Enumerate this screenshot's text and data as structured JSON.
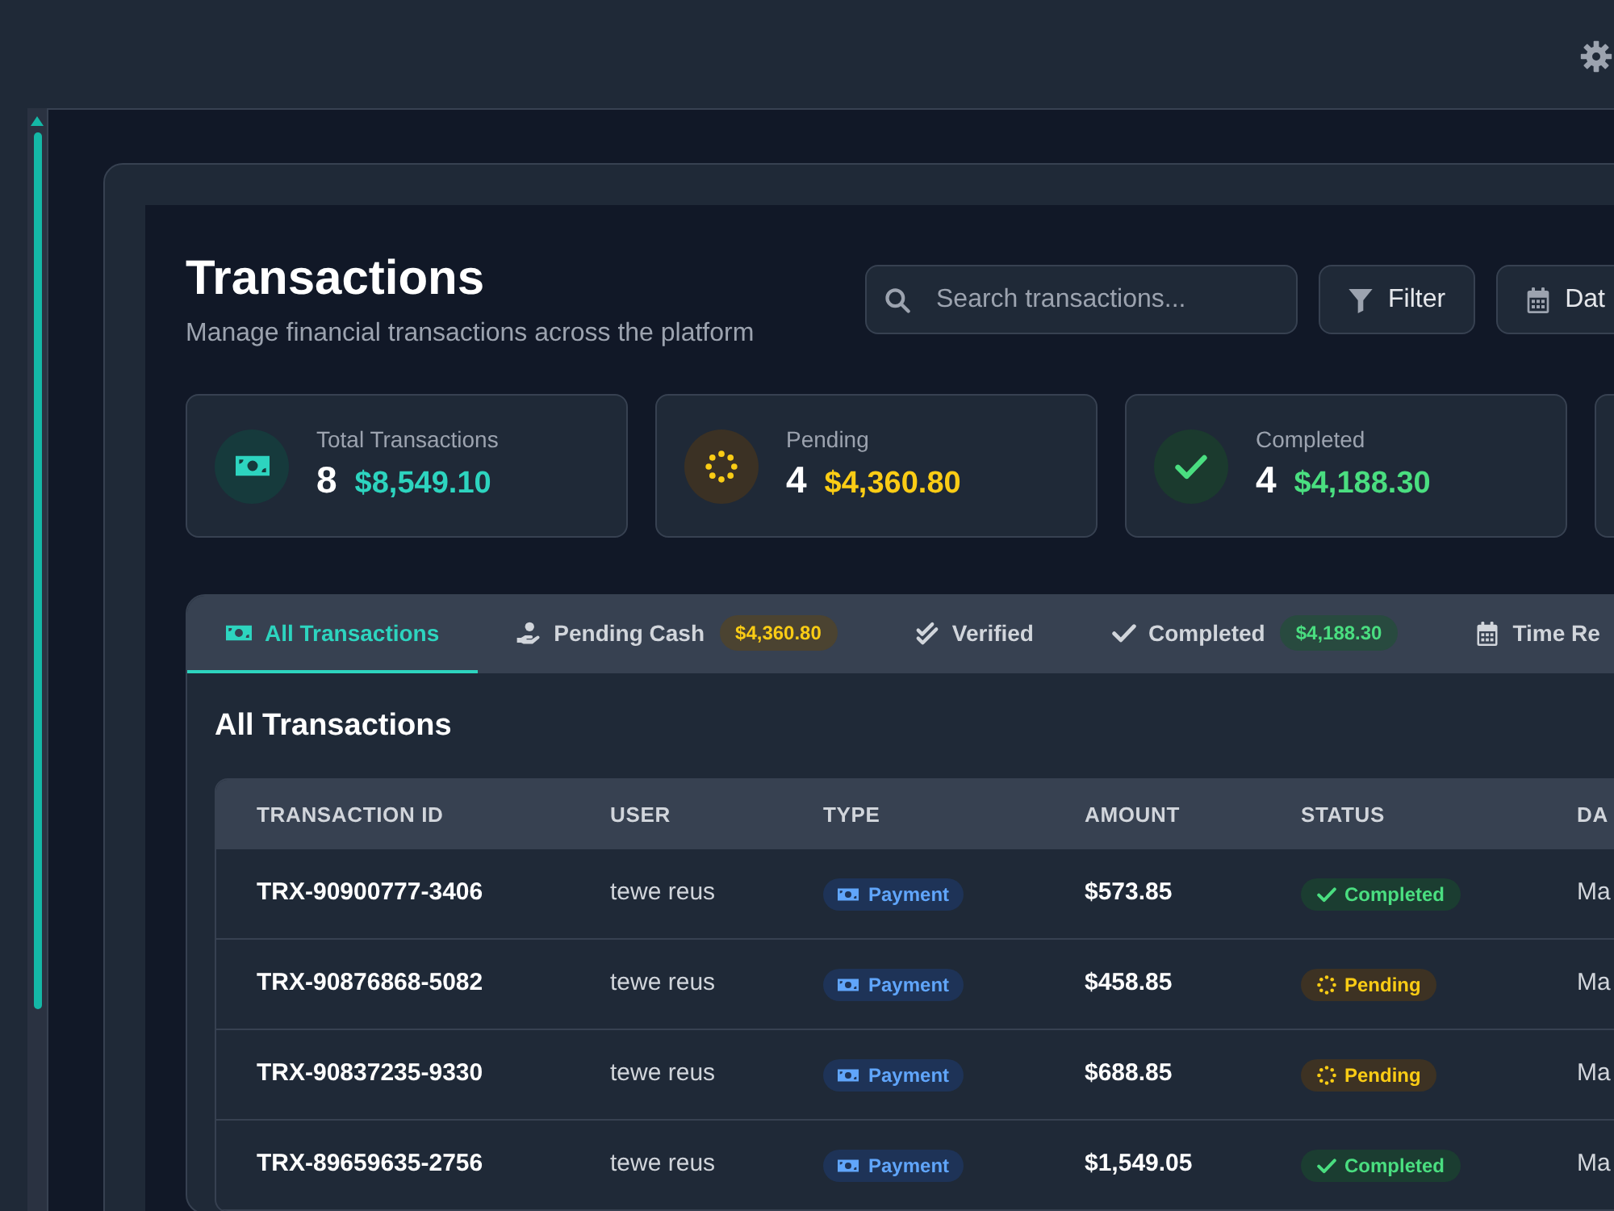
{
  "header": {
    "title": "Transactions",
    "subtitle": "Manage financial transactions across the platform"
  },
  "search": {
    "placeholder": "Search transactions..."
  },
  "buttons": [
    {
      "kind": "filter",
      "label": "Filter"
    },
    {
      "kind": "date",
      "label": "Dat"
    }
  ],
  "stats": [
    {
      "kind": "total",
      "label": "Total Transactions",
      "count": "8",
      "amount": "$8,549.10"
    },
    {
      "kind": "pending",
      "label": "Pending",
      "count": "4",
      "amount": "$4,360.80"
    },
    {
      "kind": "completed",
      "label": "Completed",
      "count": "4",
      "amount": "$4,188.30"
    }
  ],
  "tabs": [
    {
      "kind": "all",
      "label": "All Transactions",
      "selected": true
    },
    {
      "kind": "pending",
      "label": "Pending Cash",
      "badge": "$4,360.80",
      "selected": false
    },
    {
      "kind": "verified",
      "label": "Verified",
      "selected": false
    },
    {
      "kind": "completed",
      "label": "Completed",
      "badge": "$4,188.30",
      "selected": false
    },
    {
      "kind": "time",
      "label": "Time Re",
      "selected": false
    }
  ],
  "section_title": "All Transactions",
  "table": {
    "columns": [
      "TRANSACTION ID",
      "USER",
      "TYPE",
      "AMOUNT",
      "STATUS",
      "DA"
    ],
    "rows": [
      {
        "id": "TRX-90900777-3406",
        "user": "tewe reus",
        "type": {
          "kind": "payment",
          "label": "Payment"
        },
        "amount": "$573.85",
        "status": {
          "kind": "completed",
          "label": "Completed"
        },
        "column_6": "Ma"
      },
      {
        "id": "TRX-90876868-5082",
        "user": "tewe reus",
        "type": {
          "kind": "payment",
          "label": "Payment"
        },
        "amount": "$458.85",
        "status": {
          "kind": "pending",
          "label": "Pending"
        },
        "column_6": "Ma"
      },
      {
        "id": "TRX-90837235-9330",
        "user": "tewe reus",
        "type": {
          "kind": "payment",
          "label": "Payment"
        },
        "amount": "$688.85",
        "status": {
          "kind": "pending",
          "label": "Pending"
        },
        "column_6": "Ma"
      },
      {
        "id": "TRX-89659635-2756",
        "user": "tewe reus",
        "type": {
          "kind": "payment",
          "label": "Payment"
        },
        "amount": "$1,549.05",
        "status": {
          "kind": "completed",
          "label": "Completed"
        },
        "column_6": "Ma"
      }
    ]
  }
}
